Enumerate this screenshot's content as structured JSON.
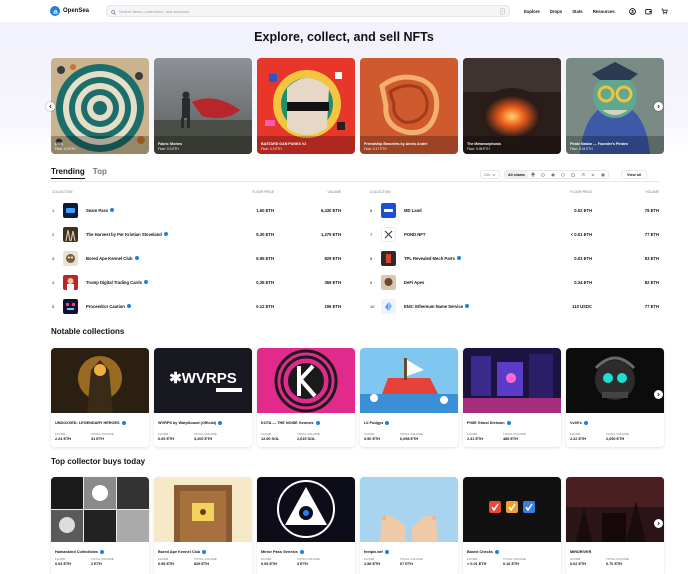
{
  "header": {
    "logo_text": "OpenSea",
    "search_placeholder": "Search items, collections, and accounts",
    "search_shortcut": "/",
    "nav": [
      "Explore",
      "Drops",
      "Stats",
      "Resources"
    ]
  },
  "hero": {
    "title": "Explore, collect, and sell NFTs",
    "cards": [
      {
        "name": "DOS",
        "floor": "Floor: 0.0 ETH"
      },
      {
        "name": "Fabric Stories",
        "floor": "Floor: 0.0 ETH"
      },
      {
        "name": "BASTARD GAN PUNKS V2",
        "floor": "Floor: 0.0 ETH"
      },
      {
        "name": "Friendship Bracelets by Alexis André",
        "floor": "Floor: 0.17 ETH"
      },
      {
        "name": "The Metamorphosis",
        "floor": "Floor: 0.05 ETH"
      },
      {
        "name": "Pirate Nation — Founder's Pirates",
        "floor": "Floor: 0.04 ETH"
      }
    ]
  },
  "tabs": [
    {
      "label": "Trending",
      "active": true
    },
    {
      "label": "Top",
      "active": false
    }
  ],
  "toolbar": {
    "timeframe": "24h",
    "chain_all": "All chains",
    "view_all": "View all"
  },
  "trending": {
    "headers": {
      "collection": "COLLECTION",
      "floor": "FLOOR PRICE",
      "volume": "VOLUME"
    },
    "left": [
      {
        "rank": "1",
        "name": "Seam Pass",
        "floor": "1.60 ETH",
        "volume": "6,430 ETH"
      },
      {
        "rank": "2",
        "name": "The Harvest by Per Kristian Stoveland",
        "floor": "5.30 ETH",
        "volume": "1,275 ETH"
      },
      {
        "rank": "3",
        "name": "Bored Ape Kennel Club",
        "floor": "6.95 ETH",
        "volume": "829 ETH"
      },
      {
        "rank": "4",
        "name": "Trump Digital Trading Cards",
        "floor": "0.35 ETH",
        "volume": "369 ETH"
      },
      {
        "rank": "5",
        "name": "Proceedru! Caution",
        "floor": "0.12 ETH",
        "volume": "196 ETH"
      }
    ],
    "right": [
      {
        "rank": "6",
        "name": "MD Land",
        "floor": "0.02 ETH",
        "volume": "79 ETH"
      },
      {
        "rank": "7",
        "name": "POND NFT",
        "floor": "< 0.01 ETH",
        "volume": "77 ETH"
      },
      {
        "rank": "8",
        "name": "TPL Revealed Mech Parts",
        "floor": "0.03 ETH",
        "volume": "83 ETH"
      },
      {
        "rank": "9",
        "name": "DeFi Apes",
        "floor": "0.34 ETH",
        "volume": "82 ETH"
      },
      {
        "rank": "10",
        "name": "ENS: Ethereum Name Service",
        "floor": "110 USDC",
        "volume": "77 ETH"
      }
    ]
  },
  "notable": {
    "title": "Notable collections",
    "cards": [
      {
        "name": "UNDOXXED: LEGENDARY HEROES",
        "floor_label": "FLOOR",
        "floor": "2.24 ETH",
        "vol_label": "TOTAL VOLUME",
        "volume": "31 ETH"
      },
      {
        "name": "WVRPS by WarpSound (Official)",
        "floor_label": "FLOOR",
        "floor": "0.09 ETH",
        "vol_label": "TOTAL VOLUME",
        "volume": "3,200 ETH"
      },
      {
        "name": "KOTA — THE NOISE Genesis",
        "floor_label": "FLOOR",
        "floor": "12.90 SOL",
        "vol_label": "TOTAL VOLUME",
        "volume": "2,615 SOL"
      },
      {
        "name": "Lil Pudgys",
        "floor_label": "FLOOR",
        "floor": "0.50 ETH",
        "vol_label": "TOTAL VOLUME",
        "volume": "6,098 ETH"
      },
      {
        "name": "PIXIE Ghost Division",
        "floor_label": "FLOOR",
        "floor": "2.31 ETH",
        "vol_label": "TOTAL VOLUME",
        "volume": "486 ETH"
      },
      {
        "name": "Vv00's",
        "floor_label": "FLOOR",
        "floor": "2.22 ETH",
        "vol_label": "TOTAL VOLUME",
        "volume": "2,090 ETH"
      }
    ]
  },
  "collector": {
    "title": "Top collector buys today",
    "cards": [
      {
        "name": "Humankind Collectibles",
        "floor_label": "FLOOR",
        "floor": "0.03 ETH",
        "vol_label": "TOTAL VOLUME",
        "volume": "2 ETH"
      },
      {
        "name": "Bored Ape Kennel Club",
        "floor_label": "FLOOR",
        "floor": "6.95 ETH",
        "vol_label": "TOTAL VOLUME",
        "volume": "829 ETH"
      },
      {
        "name": "Mirror Pass Genesis",
        "floor_label": "FLOOR",
        "floor": "0.05 ETH",
        "vol_label": "TOTAL VOLUME",
        "volume": "3 ETH"
      },
      {
        "name": "feetpix.wtf",
        "floor_label": "FLOOR",
        "floor": "2.58 ETH",
        "vol_label": "TOTAL VOLUME",
        "volume": "67 ETH"
      },
      {
        "name": "Based Checks",
        "floor_label": "FLOOR",
        "floor": "< 0.01 ETH",
        "vol_label": "TOTAL VOLUME",
        "volume": "0.16 ETH"
      },
      {
        "name": "MIRDRIVER",
        "floor_label": "FLOOR",
        "floor": "0.02 ETH",
        "vol_label": "TOTAL VOLUME",
        "volume": "0.70 ETH"
      }
    ]
  },
  "colors": {
    "accent": "#2081e2",
    "text": "#121212",
    "muted": "#707a83"
  }
}
